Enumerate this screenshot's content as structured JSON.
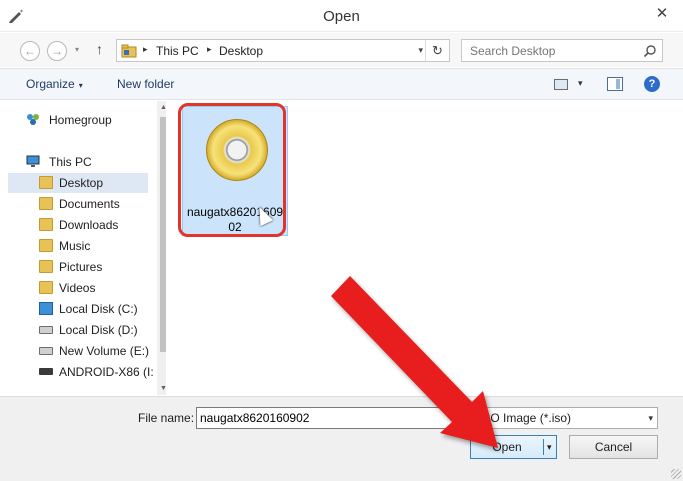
{
  "window": {
    "title": "Open",
    "close_glyph": "✕",
    "app_icon": "pencil-icon"
  },
  "nav": {
    "back_glyph": "←",
    "forward_glyph": "→",
    "recent_glyph": "▾",
    "up_glyph": "↑",
    "address": {
      "crumbs": [
        "This PC",
        "Desktop"
      ],
      "separator": "▸",
      "dropdown_glyph": "▾",
      "refresh_glyph": "↻"
    },
    "search": {
      "placeholder": "Search Desktop"
    }
  },
  "toolbar": {
    "organize_label": "Organize",
    "organize_caret": "▾",
    "new_folder_label": "New folder",
    "view_caret": "▾",
    "help_glyph": "?"
  },
  "sidebar": {
    "items": [
      {
        "label": "Homegroup",
        "icon": "homegroup-icon"
      },
      {
        "label": "This PC",
        "icon": "computer-icon"
      },
      {
        "label": "Desktop",
        "icon": "folder-icon",
        "selected": true
      },
      {
        "label": "Documents",
        "icon": "folder-icon"
      },
      {
        "label": "Downloads",
        "icon": "folder-icon"
      },
      {
        "label": "Music",
        "icon": "folder-icon"
      },
      {
        "label": "Pictures",
        "icon": "folder-icon"
      },
      {
        "label": "Videos",
        "icon": "folder-icon"
      },
      {
        "label": "Local Disk (C:)",
        "icon": "windows-drive-icon"
      },
      {
        "label": "Local Disk (D:)",
        "icon": "drive-icon"
      },
      {
        "label": "New Volume (E:)",
        "icon": "drive-icon"
      },
      {
        "label": "ANDROID-X86 (I:",
        "icon": "usb-drive-icon"
      }
    ],
    "scroll_up": "▲",
    "scroll_down": "▼"
  },
  "files": [
    {
      "name": "naugatx8620160902",
      "icon": "disc-image-icon",
      "selected": true
    }
  ],
  "footer": {
    "file_name_label": "File name:",
    "file_name_value": "naugatx8620160902",
    "file_type_value": "ISO Image (*.iso)",
    "file_type_caret": "▾",
    "open_label": "Open",
    "open_caret": "▾",
    "cancel_label": "Cancel"
  },
  "annotation": {
    "arrow_color": "#e81d1d",
    "highlight_color": "#e2342c"
  }
}
